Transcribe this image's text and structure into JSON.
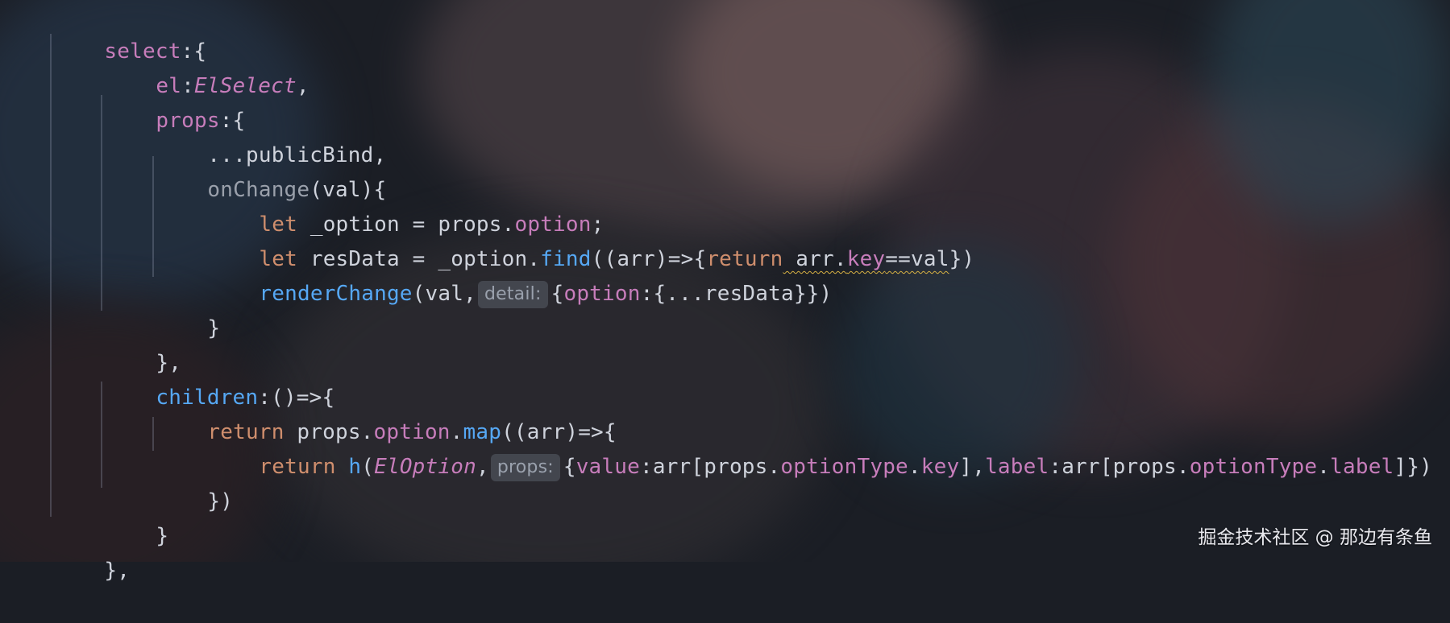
{
  "code": {
    "l1_key": "select",
    "l1_punc": ":{",
    "l2_key": "el",
    "l2_colon": ":",
    "l2_value": "ElSelect",
    "l2_comma": ",",
    "l3_key": "props",
    "l3_punc": ":{",
    "l4_text": "...publicBind,",
    "l5_fn": "onChange",
    "l5_rest": "(val){",
    "l6_let": "let",
    "l6_mid": " _option = props.",
    "l6_prop": "option",
    "l6_end": ";",
    "l7_let": "let",
    "l7_mid": " resData = _option.",
    "l7_fn": "find",
    "l7_args": "((arr)=>{",
    "l7_return": "return",
    "l7_arr": " arr.",
    "l7_key": "key",
    "l7_eq": "==val",
    "l7_end": "})",
    "l8_fn": "renderChange",
    "l8_open": "(val,",
    "l8_hint": "detail:",
    "l8_brace": "{",
    "l8_option": "option",
    "l8_end": ":{...resData}})",
    "l9_text": "}",
    "l10_text": "},",
    "l11_key": "children",
    "l11_end": ":()=>{",
    "l12_return": "return",
    "l12_props": " props.",
    "l12_option": "option",
    "l12_dot": ".",
    "l12_map": "map",
    "l12_end": "((arr)=>{",
    "l13_return": "return",
    "l13_h": "h",
    "l13_open": "(",
    "l13_cls": "ElOption",
    "l13_comma": ",",
    "l13_hint": "props:",
    "l13_brace": "{",
    "l13_value": "value",
    "l13_arr1": ":arr[props.",
    "l13_optType1": "optionType",
    "l13_dot1": ".",
    "l13_key": "key",
    "l13_close1": "],",
    "l13_label": "label",
    "l13_arr2": ":arr[props.",
    "l13_optType2": "optionType",
    "l13_dot2": ".",
    "l13_label2": "label",
    "l13_end": "]})",
    "l14_text": "})",
    "l15_text": "}",
    "l16_text": "},"
  },
  "watermark": "掘金技术社区 @ 那边有条鱼",
  "colors": {
    "keyword": "#cf8e6d",
    "property": "#c77dbb",
    "function": "#56a8f5",
    "text": "#cfd3dc",
    "inlay_hint": "#9aa1ad"
  }
}
